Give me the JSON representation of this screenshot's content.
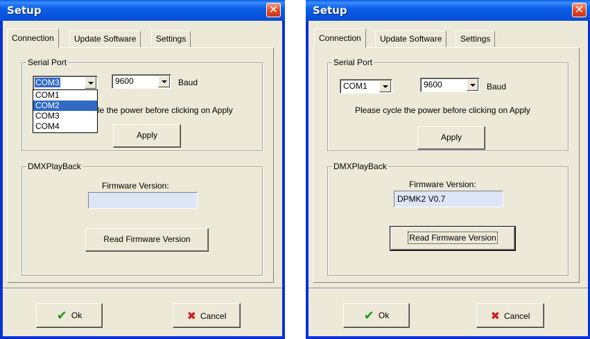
{
  "windows": [
    {
      "title": "Setup",
      "tabs": [
        "Connection",
        "Update Software",
        "Settings"
      ],
      "serial_port": {
        "group_label": "Serial Port",
        "port_value": "COM3",
        "baud_value": "9600",
        "baud_label": "Baud",
        "instruction_partial": "cle the power before clicking on Apply",
        "apply_label": "Apply",
        "dropdown_options": [
          "COM1",
          "COM2",
          "COM3",
          "COM4"
        ],
        "dropdown_highlighted": "COM2"
      },
      "dmx": {
        "group_label": "DMXPlayBack",
        "firmware_label": "Firmware Version:",
        "firmware_value": "",
        "read_label": "Read Firmware Version"
      },
      "ok_label": "Ok",
      "cancel_label": "Cancel"
    },
    {
      "title": "Setup",
      "tabs": [
        "Connection",
        "Update Software",
        "Settings"
      ],
      "serial_port": {
        "group_label": "Serial Port",
        "port_value": "COM1",
        "baud_value": "9600",
        "baud_label": "Baud",
        "instruction": "Please cycle the power before clicking on Apply",
        "apply_label": "Apply"
      },
      "dmx": {
        "group_label": "DMXPlayBack",
        "firmware_label": "Firmware Version:",
        "firmware_value": "DPMK2 V0.7",
        "read_label": "Read Firmware Version"
      },
      "ok_label": "Ok",
      "cancel_label": "Cancel"
    }
  ],
  "icons": {
    "close": "close-icon",
    "ok": "check-icon",
    "cancel": "x-icon"
  },
  "colors": {
    "titlebar": "#0a5fe8",
    "window_bg": "#ece9d8",
    "selection": "#316ac5"
  }
}
